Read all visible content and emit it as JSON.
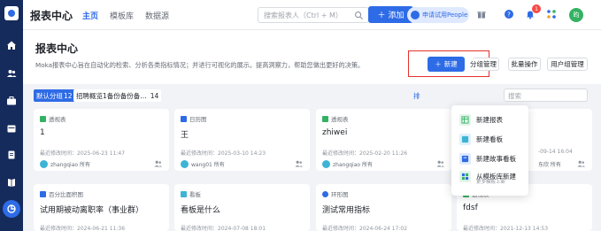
{
  "topbar": {
    "title": "报表中心",
    "tabs": [
      {
        "label": "主页",
        "active": true
      },
      {
        "label": "模板库",
        "active": false
      },
      {
        "label": "数据源",
        "active": false
      }
    ],
    "search_placeholder": "搜索报表人（Ctrl + M）",
    "add_label": "添加",
    "trial_label": "申请试用People",
    "notification_count": "1",
    "user_initial": "昀"
  },
  "page": {
    "title": "报表中心",
    "description": "Moka报表中心旨在自动化的检索、分析各类指标情况；并进行可视化的展示。提高洞察力，帮助您做出更好的决策。"
  },
  "actions": {
    "new_label": "新建",
    "category_manage_label": "分组管理",
    "batch_label": "批量操作",
    "user_group_label": "用户组管理"
  },
  "groups": {
    "default_label": "默认分组",
    "default_count": "12",
    "other_label": "招聘概览1备份备份备…",
    "other_count": "14",
    "sort_label": "排",
    "search_placeholder": "搜索"
  },
  "cards_row1": [
    {
      "type": "透视表",
      "name": "1",
      "time": "最近修改时间：2025-06-23 11:47",
      "owner": "zhangqiao 所有"
    },
    {
      "type": "日历图",
      "name": "王",
      "time": "最近修改时间：2025-03-10 14:23",
      "owner": "wang01 所有"
    },
    {
      "type": "透视表",
      "name": "zhiwei",
      "time": "最近修改时间：2025-02-20 11:26",
      "owner": "zhangqiao 所有"
    },
    {
      "type": "",
      "name": "",
      "time": "-09-14 16:04",
      "owner": "东欣 所有"
    }
  ],
  "cards_row2": [
    {
      "type": "百分比面积图",
      "name": "试用期被动离职率（事业群）",
      "time": "最近修改时间：2024-06-21 11:36"
    },
    {
      "type": "看板",
      "name": "看板是什么",
      "time": "最近修改时间：2024-07-08 18:01"
    },
    {
      "type": "环形图",
      "name": "测试常用指标",
      "time": "最近修改时间：2024-06-24 17:02"
    },
    {
      "type": "透视表",
      "name": "fdsf",
      "time": "最近修改时间：2021-12-13 14:53"
    }
  ],
  "dropdown": {
    "items": [
      {
        "label": "新建报表",
        "icon": "report-icon"
      },
      {
        "label": "新建看板",
        "icon": "dashboard-icon"
      },
      {
        "label": "新建故事看板",
        "icon": "story-icon"
      },
      {
        "label": "从模板库新建",
        "icon": "template-icon"
      }
    ],
    "sub_label": "更多模板上新"
  },
  "colors": {
    "primary": "#2e6be6",
    "sidebar": "#152b5c",
    "highlight_box": "#e5322d"
  }
}
